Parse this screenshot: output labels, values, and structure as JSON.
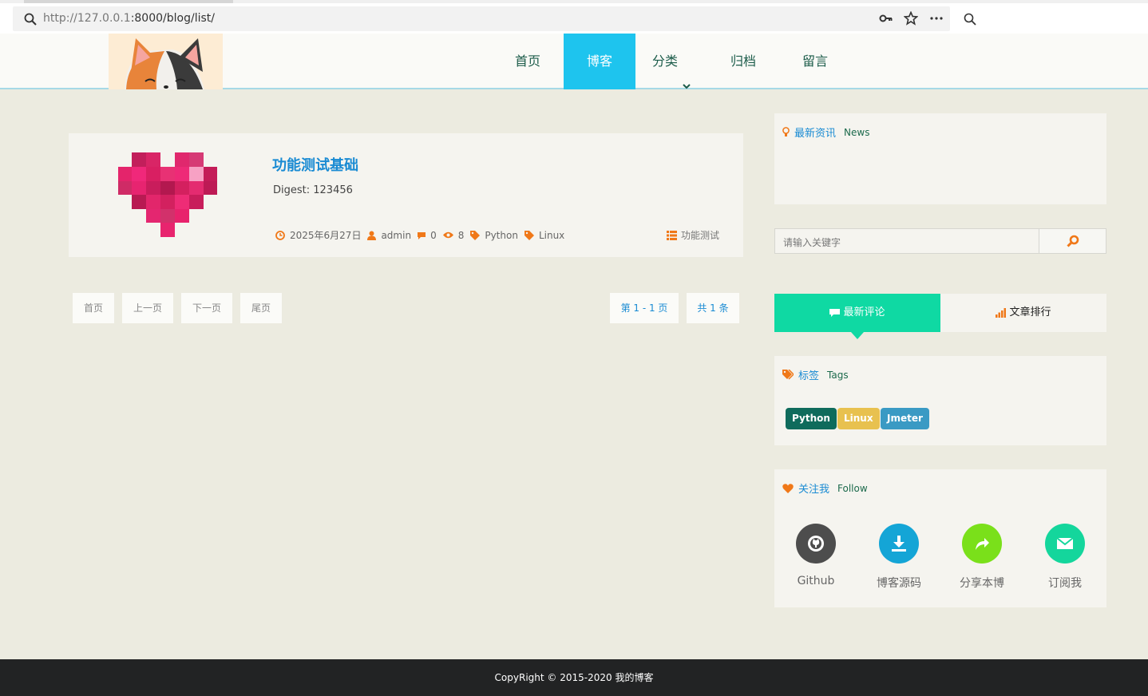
{
  "browser": {
    "url_host": "http://127.0.0.1",
    "url_path": ":8000/blog/list/"
  },
  "nav": {
    "items": [
      "首页",
      "博客",
      "分类",
      "归档",
      "留言"
    ],
    "active": "博客"
  },
  "article": {
    "title": "功能测试基础",
    "digest": "Digest:  123456",
    "date": "2025年6月27日",
    "author": "admin",
    "comments": "0",
    "views": "8",
    "tags": [
      "Python",
      "Linux"
    ],
    "category": "功能测试"
  },
  "pagination": {
    "first": "首页",
    "prev": "上一页",
    "next": "下一页",
    "last": "尾页",
    "page_info": "第 1 - 1 页",
    "total": "共 1 条"
  },
  "sidebar": {
    "news": {
      "title": "最新资讯",
      "en": "News"
    },
    "search": {
      "placeholder": "请输入关键字"
    },
    "tabs": [
      "最新评论",
      "文章排行"
    ],
    "tags_box": {
      "title": "标签",
      "en": "Tags"
    },
    "tags": [
      {
        "label": "Python",
        "color": "#0f6b5c"
      },
      {
        "label": "Linux",
        "color": "#e8c14f"
      },
      {
        "label": "Jmeter",
        "color": "#3a9ac4"
      }
    ],
    "follow_box": {
      "title": "关注我",
      "en": "Follow"
    },
    "follow": [
      {
        "label": "Github",
        "color": "#4d4d4d"
      },
      {
        "label": "博客源码",
        "color": "#14a5d6"
      },
      {
        "label": "分享本博",
        "color": "#7ae01a"
      },
      {
        "label": "订阅我",
        "color": "#14d69c"
      }
    ]
  },
  "colors": {
    "accent": "#1ec4ee",
    "link": "#1a8bd3",
    "orange": "#f07818",
    "teal": "#0fd9a3"
  },
  "footer": {
    "text": "CopyRight © 2015-2020 我的博客"
  }
}
